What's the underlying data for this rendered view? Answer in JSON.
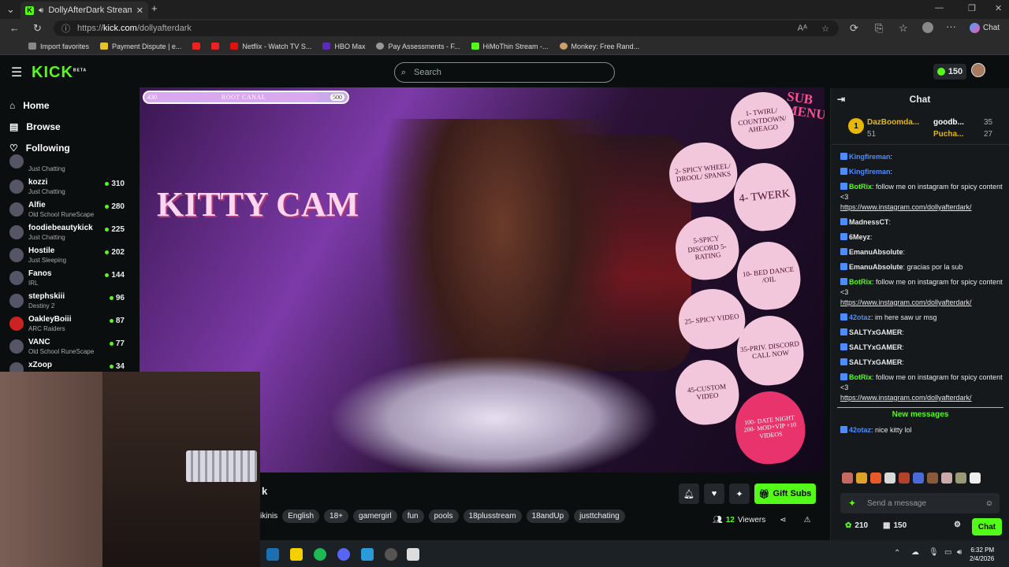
{
  "browser": {
    "tab_title": "DollyAfterDark Stream - Wat",
    "url_prefix": "https://",
    "url_host": "kick.com",
    "url_path": "/dollyafterdark",
    "copilot_label": "Chat",
    "bookmarks": [
      "Import favorites",
      "Payment Dispute | e...",
      "Netflix - Watch TV S...",
      "HBO Max",
      "Pay Assessments - F...",
      "HiMoThin Stream -...",
      "Monkey: Free Rand..."
    ]
  },
  "site": {
    "logo": "KICK",
    "logo_sup": "BETA",
    "search_placeholder": "Search",
    "coins": "150",
    "nav": [
      {
        "label": "Home",
        "icon": "home-icon"
      },
      {
        "label": "Browse",
        "icon": "browse-icon"
      },
      {
        "label": "Following",
        "icon": "heart-icon"
      }
    ],
    "channels": [
      {
        "name": "",
        "category": "Just Chatting",
        "viewers": ""
      },
      {
        "name": "kozzi",
        "category": "Just Chatting",
        "viewers": "310"
      },
      {
        "name": "Alfie",
        "category": "Old School RuneScape",
        "viewers": "280"
      },
      {
        "name": "foodiebeautykick",
        "category": "Just Chatting",
        "viewers": "225"
      },
      {
        "name": "Hostile",
        "category": "Just Sleeping",
        "viewers": "202"
      },
      {
        "name": "Fanos",
        "category": "IRL",
        "viewers": "144"
      },
      {
        "name": "stephskiii",
        "category": "Destiny 2",
        "viewers": "96"
      },
      {
        "name": "OakleyBoiii",
        "category": "ARC Raiders",
        "viewers": "87"
      },
      {
        "name": "VANC",
        "category": "Old School RuneScape",
        "viewers": "77"
      },
      {
        "name": "xZoop",
        "category": "",
        "viewers": "34"
      }
    ]
  },
  "video": {
    "goal_min": "430",
    "goal_label": "ROOT CANAL",
    "goal_max": "500",
    "goal_progress": 0.86,
    "overlay_text": "KITTY CAM",
    "menu_title": "SUB MENU",
    "menu_items": [
      "1- TWIRL/ COUNTDOWN/ AHEAGO",
      "2- SPICY WHEEL/ DROOL/ SPANKS",
      "4- TWERK",
      "5-SPICY DISCORD 5-RATING",
      "10- BED DANCE /OIL",
      "25- SPICY VIDEO",
      "35-PRIV. DISCORD CALL NOW",
      "45-CUSTOM VIDEO",
      "100- DATE NIGHT 200- MOD+VIP +10 VIDEOS"
    ]
  },
  "stream_info": {
    "title_fragment": "k",
    "first_tag_fragment": "ikinis",
    "tags": [
      "English",
      "18+",
      "gamergirl",
      "fun",
      "pools",
      "18plusstream",
      "18andUp",
      "justtchating"
    ],
    "gift_label": "Gift Subs",
    "viewers_count": "12",
    "viewers_label": "Viewers"
  },
  "chat": {
    "title": "Chat",
    "leaderboard": [
      {
        "rank": "1",
        "name": "DazBoomda...",
        "count": "51"
      },
      {
        "name": "goodb...",
        "count": "35"
      },
      {
        "name": "Pucha...",
        "count": "27"
      }
    ],
    "messages": [
      {
        "user": "Kingfireman",
        "text": ":",
        "color": "#4d8cff"
      },
      {
        "user": "Kingfireman",
        "text": ":",
        "color": "#4d8cff"
      },
      {
        "user": "BotRix",
        "text": ": follow me on instagram for spicy content <3",
        "link": "https://www.instagram.com/dollyafterdark/",
        "color": "#53fc18"
      },
      {
        "user": "MadnessCT",
        "text": ":",
        "color": "#e8e8e8"
      },
      {
        "user": "6Meyz",
        "text": ":",
        "color": "#e8e8e8"
      },
      {
        "user": "EmanuAbsolute",
        "text": ":",
        "color": "#e8e8e8"
      },
      {
        "user": "EmanuAbsolute",
        "text": ": gracias por la sub",
        "color": "#e8e8e8"
      },
      {
        "user": "BotRix",
        "text": ": follow me on instagram for spicy content <3",
        "link": "https://www.instagram.com/dollyafterdark/",
        "color": "#53fc18"
      },
      {
        "user": "42otaz",
        "text": ": im here saw ur msg",
        "color": "#4d8cff"
      },
      {
        "user": "SALTYxGAMER",
        "text": ":",
        "color": "#e8e8e8"
      },
      {
        "user": "SALTYxGAMER",
        "text": ":",
        "color": "#e8e8e8"
      },
      {
        "user": "SALTYxGAMER",
        "text": ":",
        "color": "#e8e8e8"
      },
      {
        "user": "BotRix",
        "text": ": follow me on instagram for spicy content <3",
        "link": "https://www.instagram.com/dollyafterdark/",
        "color": "#53fc18"
      }
    ],
    "new_messages_label": "New messages",
    "new_message": {
      "user": "42otaz",
      "text": ": nice kitty lol",
      "color": "#4d8cff"
    },
    "send_placeholder": "Send a message",
    "points": "210",
    "balance": "150",
    "chat_button": "Chat"
  },
  "taskbar": {
    "time": "6:32 PM",
    "date": "2/4/2026"
  }
}
